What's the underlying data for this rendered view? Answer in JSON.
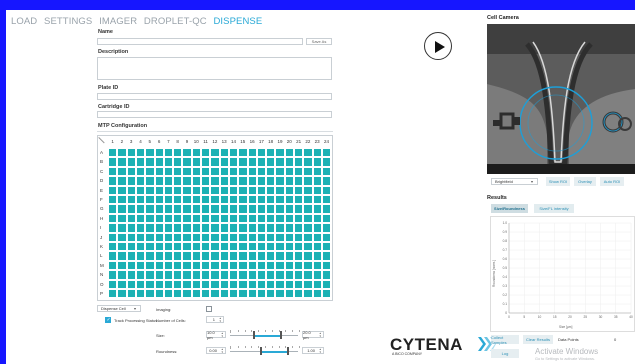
{
  "nav": {
    "items": [
      {
        "label": "LOAD",
        "active": false
      },
      {
        "label": "SETTINGS",
        "active": false
      },
      {
        "label": "IMAGER",
        "active": false
      },
      {
        "label": "DROPLET-QC",
        "active": false
      },
      {
        "label": "DISPENSE",
        "active": true
      }
    ]
  },
  "form": {
    "name_label": "Name",
    "name_value": "",
    "save_as": "Save As",
    "description_label": "Description",
    "description_value": "",
    "plate_id_label": "Plate ID",
    "plate_id_value": "",
    "cartridge_id_label": "Cartridge ID",
    "cartridge_id_value": "",
    "mtp_label": "MTP Configuration"
  },
  "mtp": {
    "columns": [
      "1",
      "2",
      "3",
      "4",
      "5",
      "6",
      "7",
      "8",
      "9",
      "10",
      "11",
      "12",
      "13",
      "14",
      "15",
      "16",
      "17",
      "18",
      "19",
      "20",
      "21",
      "22",
      "23",
      "24"
    ],
    "rows": [
      "A",
      "B",
      "C",
      "D",
      "E",
      "F",
      "G",
      "H",
      "I",
      "J",
      "K",
      "L",
      "M",
      "N",
      "O",
      "P"
    ],
    "well_color": "#1db2b4"
  },
  "controls": {
    "mode_select": "Dispense Cell",
    "track_label": "Track Processing Status",
    "track_checked": true,
    "imaging_label": "Imaging:",
    "imaging_checked": false,
    "num_cells_label": "Number of Cells:",
    "num_cells_value": "1",
    "size_label": "Size:",
    "size_min": "10.0 µm",
    "size_max": "20.0 µm",
    "size_range": [
      0.35,
      0.75
    ],
    "roundness_label": "Roundness:",
    "roundness_min": "0.00",
    "roundness_max": "1.00",
    "roundness_range": [
      0.45,
      0.85
    ]
  },
  "brand": {
    "logo": "CYTENA",
    "sub": "A BICO COMPANY",
    "accent": "#2aa9d6"
  },
  "camera": {
    "title": "Cell Camera",
    "mode_select": "Brightfield",
    "show_roi": "Show ROI",
    "overlay": "Overlay",
    "auto_roi": "Auto ROI"
  },
  "results": {
    "title": "Results",
    "tabs": [
      {
        "label": "Size/Roundness",
        "selected": true
      },
      {
        "label": "Size/FL intensity",
        "selected": false
      }
    ],
    "ylabel": "Roundness [norm.]",
    "xlabel": "Size [µm]",
    "y_ticks": [
      "1.0",
      "0.9",
      "0.8",
      "0.7",
      "0.6",
      "0.5",
      "0.4",
      "0.3",
      "0.2",
      "0.1",
      "0"
    ],
    "x_ticks": [
      "0",
      "5",
      "10",
      "15",
      "20",
      "25",
      "30",
      "35",
      "40"
    ],
    "collect_samples": "Collect Samples",
    "clear_results": "Clear Results",
    "data_points_label": "Data Points",
    "data_points_value": "0",
    "log": "Log"
  },
  "os_overlay": {
    "title": "Activate Windows",
    "sub": "Go to Settings to activate Windows."
  }
}
